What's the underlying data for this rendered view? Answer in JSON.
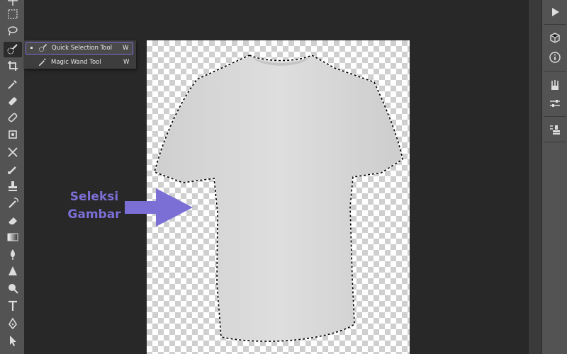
{
  "flyout": {
    "items": [
      {
        "label": "Quick Selection Tool",
        "shortcut": "W"
      },
      {
        "label": "Magic Wand Tool",
        "shortcut": "W"
      }
    ]
  },
  "annotation": {
    "line1": "Seleksi",
    "line2": "Gambar",
    "color": "#7b6fd6"
  },
  "toolbar": {
    "tools": [
      "move-icon",
      "marquee-icon",
      "lasso-icon",
      "quick-selection-icon",
      "crop-icon",
      "eyedropper-icon",
      "healing-brush-icon",
      "bandage-icon",
      "patch-icon",
      "content-aware-move-icon",
      "brush-icon",
      "clone-stamp-icon",
      "history-brush-icon",
      "eraser-icon",
      "gradient-icon",
      "blur-icon",
      "sharpen-icon",
      "dodge-icon",
      "type-icon",
      "pen-icon",
      "path-selection-icon"
    ]
  },
  "right_panel": {
    "buttons": [
      "play-icon",
      "3d-cube-icon",
      "info-icon",
      "brushes-icon",
      "adjustments-icon",
      "clone-source-icon"
    ]
  }
}
